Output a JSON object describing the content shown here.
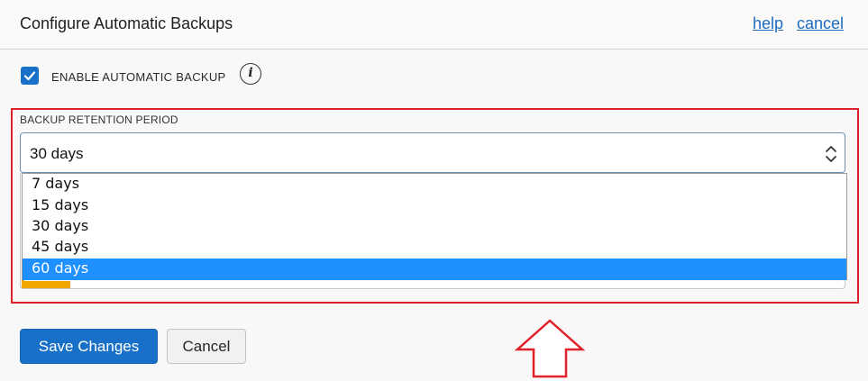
{
  "header": {
    "title": "Configure Automatic Backups",
    "help_label": "help",
    "cancel_label": "cancel"
  },
  "enable_backup": {
    "label": "ENABLE AUTOMATIC BACKUP",
    "checked": true,
    "info_glyph": "i"
  },
  "retention": {
    "label": "BACKUP RETENTION PERIOD",
    "selected_value": "30 days",
    "options": [
      "7 days",
      "15 days",
      "30 days",
      "45 days",
      "60 days"
    ],
    "highlighted_option": "60 days"
  },
  "footer": {
    "save_label": "Save Changes",
    "cancel_label": "Cancel"
  },
  "colors": {
    "accent": "#1870c8",
    "highlight_border": "#e0202a",
    "option_highlight": "#1e90ff",
    "warning_strip": "#f0a500"
  }
}
